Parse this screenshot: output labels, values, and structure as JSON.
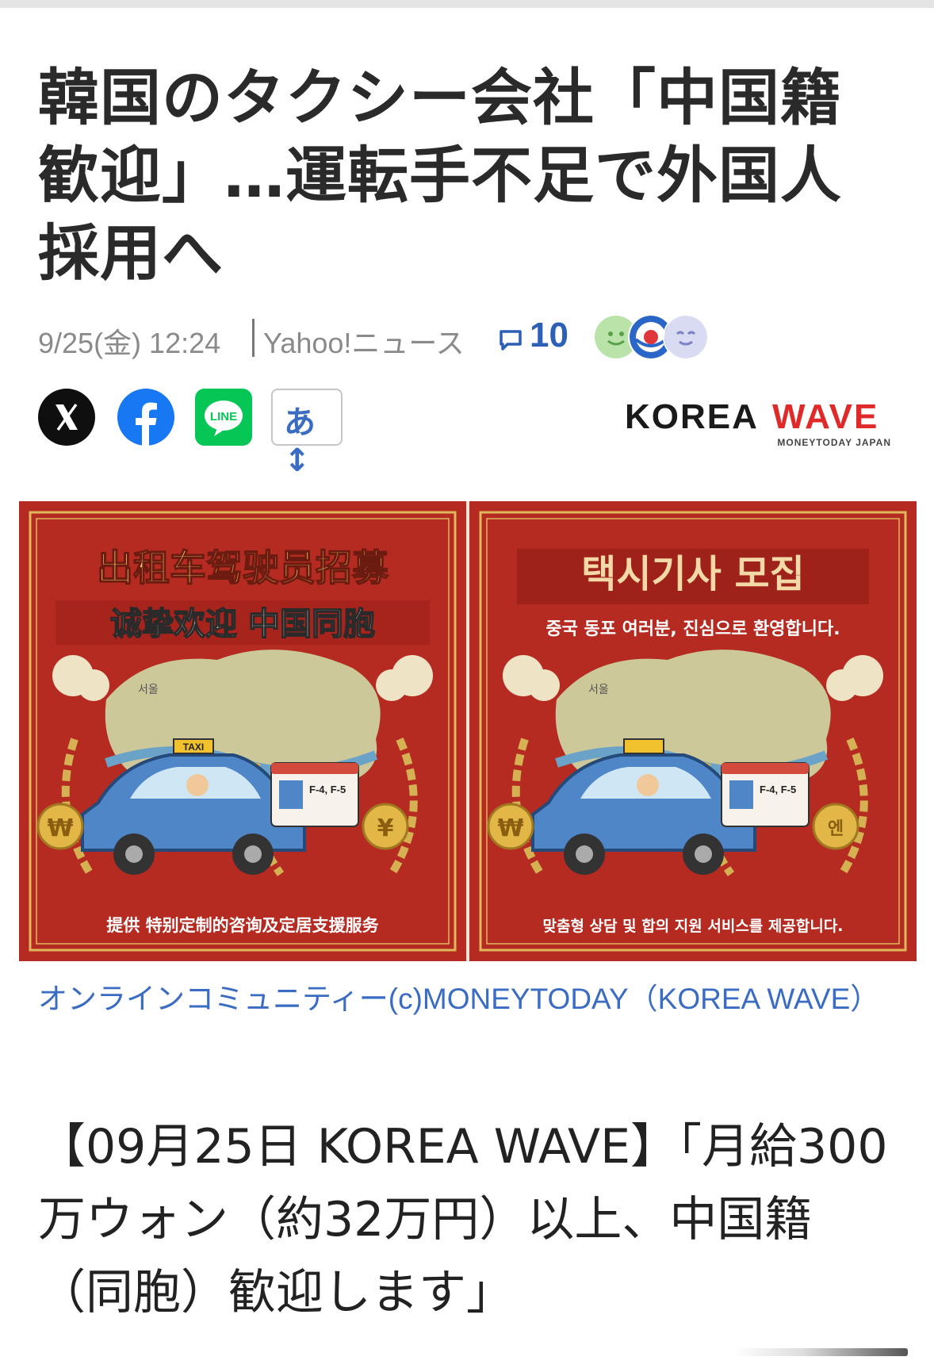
{
  "article": {
    "title": "韓国のタクシー会社「中国籍歓迎」…運転手不足で外国人採用へ",
    "date": "9/25(金) 12:24",
    "source": "Yahoo!ニュース",
    "comment_count": "10"
  },
  "share": {
    "font_size_label": "あ↕"
  },
  "publisher_logo": {
    "primary": "KOREA",
    "accent": "WAVE",
    "tagline": "MONEYTODAY JAPAN",
    "accent_color": "#e02a2a"
  },
  "images": {
    "left_poster": {
      "title": "出租车驾驶员招募",
      "subtitle": "诚挚欢迎 中国同胞",
      "taxi_sign": "TAXI",
      "visa": "F-4, F-5",
      "city": "서울",
      "currency": [
        "₩",
        "¥"
      ],
      "footer": "提供 特别定制的咨询及定居支援服务"
    },
    "right_poster": {
      "title": "택시기사 모집",
      "subtitle": "중국 동포 여러분, 진심으로 환영합니다.",
      "visa": "F-4, F-5",
      "city": "서울",
      "currency": [
        "₩",
        "엔"
      ],
      "footer": "맞춤형 상담 및 합의 지원 서비스를 제공합니다."
    },
    "caption": "オンラインコミュニティー(c)MONEYTODAY（KOREA WAVE）"
  },
  "body": {
    "lead": "【09月25日 KOREA WAVE】「月給300万ウォン（約32万円）以上、中国籍（同胞）歓迎します」"
  },
  "colors": {
    "poster_red": "#b22a22",
    "poster_gold": "#e8c66a",
    "link_blue": "#3b6cc3"
  }
}
